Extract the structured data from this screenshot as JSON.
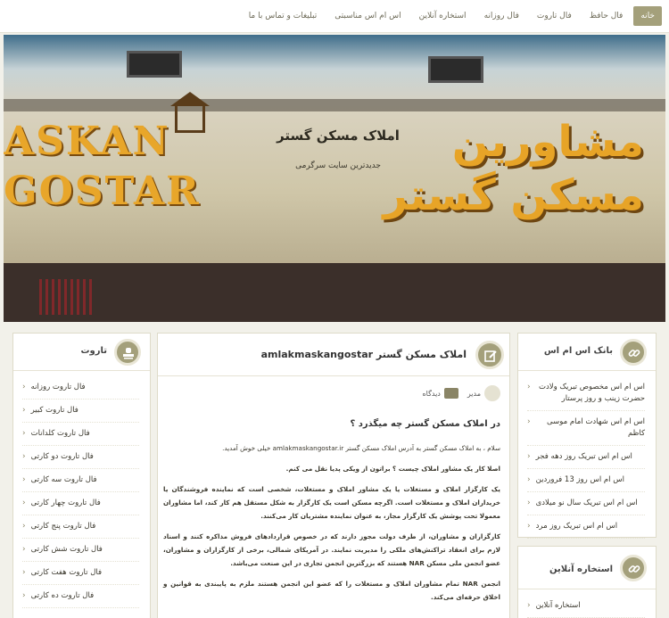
{
  "nav": {
    "items": [
      {
        "label": "خانه",
        "active": true
      },
      {
        "label": "فال حافظ"
      },
      {
        "label": "فال تاروت"
      },
      {
        "label": "فال روزانه"
      },
      {
        "label": "استخاره آنلاین"
      },
      {
        "label": "اس ام اس مناسبتی"
      },
      {
        "label": "تبلیغات و تماس با ما"
      }
    ]
  },
  "hero": {
    "site_title": "املاک مسکن گستر",
    "tagline": "جدیدترین سایت سرگرمی",
    "sign_en_line1": "ASKAN",
    "sign_en_line2": "GOSTAR",
    "sign_fa_line1": "مشاورین",
    "sign_fa_line2": "مسکن گستر"
  },
  "article": {
    "title": "املاک مسکن گستر amlakmaskangostar",
    "author": "مدیر",
    "comment_label": "دیدگاه",
    "heading": "در املاک مسکن گستر چه میگذرد ؟",
    "paragraphs": [
      "سلام ، به املاک مسکن گستر به آدرس املاک مسکن گستر amlakmaskangostar.ir خیلی خوش آمدید.",
      "اصلا کار یک مشاور املاک چیست ؟ براتون از ویکی پدیا نقل می کنم.",
      "یک کارگزار املاک و مستغلات یا یک مشاور املاک و مستغلات، شخصی است که نماینده فروشندگان یا خریداران املاک و مستغلات است. اگرچه مسکن است یک کارگزار به شکل مستقل هم کار کند، اما مشاوران معمولا تحت پوشش یک کارگزار مجاز، به عنوان نماینده مشتریان کار می‌کنند.",
      "کارگزاران و مشاوران، از طرف دولت مجوز دارند که در خصوص قراردادهای فروش مذاکره کنند و اسناد لازم برای انعقاد تراکنش‌های ملکی را مدیریت نمایند. در آمریکای شمالی، برخی از کارگزاران و مشاوران، عضو انجمن ملی مسکن NAR هستند که بزرگترین انجمن تجاری در این صنعت می‌باشد.",
      "انجمن NAR تمام مشاوران املاک و مستغلات را که عضو این انجمن هستند ملزم به پایبندی به قوانین و اخلاق حرفه‌ای می‌کند."
    ]
  },
  "left_box": {
    "title": "تاروت",
    "items": [
      "فال تاروت روزانه",
      "فال تاروت کبیر",
      "فال تاروت کلدانات",
      "فال تاروت دو کارتی",
      "فال تاروت سه کارتی",
      "فال تاروت چهار کارتی",
      "فال تاروت پنج کارتی",
      "فال تاروت شش کارتی",
      "فال تاروت هفت کارتی",
      "فال تاروت ده کارتی"
    ]
  },
  "right_box1": {
    "title": "بانک اس ام اس",
    "items": [
      "اس ام اس مخصوص تبریک ولادت حضرت زینب و روز پرستار",
      "اس ام اس شهادت امام موسی کاظم",
      "اس ام اس تبریک روز دهه فجر",
      "اس ام اس روز 13 فروردین",
      "اس ام اس تبریک سال نو میلادی",
      "اس ام اس تبریک روز مرد"
    ]
  },
  "right_box2": {
    "title": "استخاره آنلاین",
    "items": [
      "استخاره آنلاین"
    ]
  }
}
